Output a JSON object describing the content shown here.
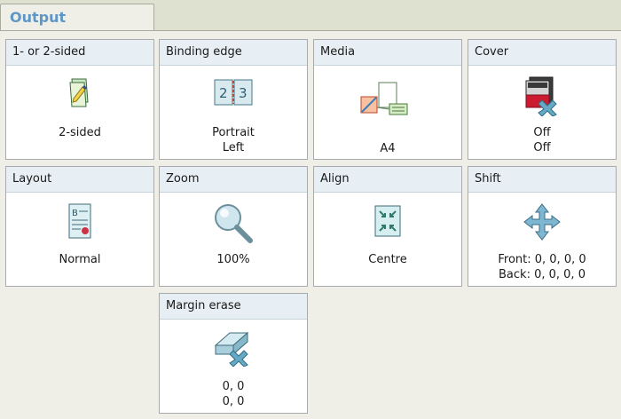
{
  "tab": {
    "label": "Output"
  },
  "tiles": {
    "sided": {
      "title": "1- or 2-sided",
      "value": "2-sided"
    },
    "binding": {
      "title": "Binding edge",
      "value1": "Portrait",
      "value2": "Left"
    },
    "media": {
      "title": "Media",
      "value": "A4"
    },
    "cover": {
      "title": "Cover",
      "value1": "Off",
      "value2": "Off"
    },
    "layout": {
      "title": "Layout",
      "value": "Normal"
    },
    "zoom": {
      "title": "Zoom",
      "value": "100%"
    },
    "align": {
      "title": "Align",
      "value": "Centre"
    },
    "shift": {
      "title": "Shift",
      "value1": "Front: 0, 0, 0, 0",
      "value2": "Back: 0, 0, 0, 0"
    },
    "margin": {
      "title": "Margin erase",
      "value1": "0, 0",
      "value2": "0, 0"
    }
  },
  "icons": {
    "sided": "two-sided-page-icon",
    "binding": "binding-edge-icon",
    "media": "media-tray-icon",
    "cover": "cover-off-icon",
    "layout": "page-layout-icon",
    "zoom": "magnifier-icon",
    "align": "align-centre-icon",
    "shift": "shift-arrows-icon",
    "margin": "margin-erase-icon"
  }
}
